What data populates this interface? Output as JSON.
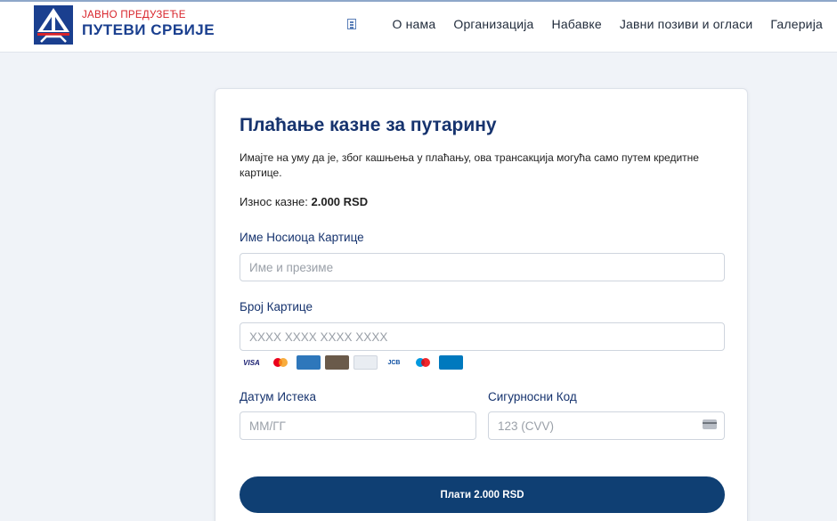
{
  "header": {
    "brand_top": "ЈАВНО ПРЕДУЗЕЋЕ",
    "brand_bottom": "ПУТЕВИ СРБИЈЕ",
    "nav": [
      "О нама",
      "Организација",
      "Набавке",
      "Јавни позиви и огласи",
      "Галерија"
    ]
  },
  "form": {
    "title": "Плаћање казне за путарину",
    "notice": "Имајте на уму да је, због кашњења у плаћању, ова трансакција могућа само путем кредитне картице.",
    "amount_label": "Износ казне:",
    "amount_value": "2.000 RSD",
    "cardholder_label": "Име Носиоца Картице",
    "cardholder_placeholder": "Име и презиме",
    "card_number_label": "Број Картице",
    "card_number_placeholder": "XXXX XXXX XXXX XXXX",
    "expiry_label": "Датум Истека",
    "expiry_placeholder": "ММ/ГГ",
    "cvv_label": "Сигурносни Код",
    "cvv_placeholder": "123 (CVV)",
    "pay_button": "Плати 2.000 RSD",
    "card_brands": [
      "VISA",
      "Mastercard",
      "American Express",
      "Discover",
      "Generic",
      "JCB",
      "Maestro",
      "Diners",
      "Other"
    ]
  },
  "colors": {
    "brand_blue": "#1a3f8f",
    "brand_red": "#d8232a",
    "title_blue": "#16336e",
    "button": "#0f3f73",
    "page_bg": "#f0f3f8"
  }
}
